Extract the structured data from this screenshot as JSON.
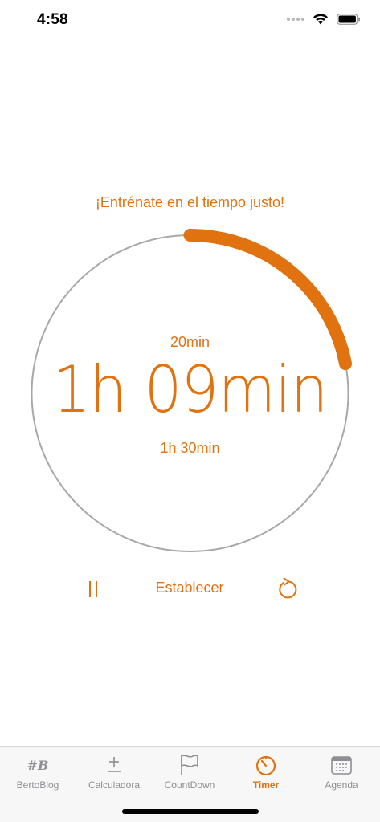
{
  "status_bar": {
    "time": "4:58",
    "icons": [
      "signal-dots-icon",
      "wifi-icon",
      "battery-icon"
    ]
  },
  "timer": {
    "tagline": "¡Entrénate en el tiempo justo!",
    "elapsed": "20min",
    "remaining": "1h 09min",
    "total": "1h 30min",
    "progress_fraction": 0.22,
    "accent_color": "#e0720f",
    "track_color": "#a8a8a8"
  },
  "controls": {
    "pause_icon": "pause-icon",
    "set_label": "Establecer",
    "reset_icon": "reset-icon"
  },
  "tab_bar": {
    "tabs": [
      {
        "label": "BertoBlog",
        "icon": "#B",
        "active": false
      },
      {
        "label": "Calculadora",
        "icon": "plus-minus-icon",
        "active": false
      },
      {
        "label": "CountDown",
        "icon": "flag-icon",
        "active": false
      },
      {
        "label": "Timer",
        "icon": "timer-icon",
        "active": true
      },
      {
        "label": "Agenda",
        "icon": "calendar-icon",
        "active": false
      }
    ]
  }
}
